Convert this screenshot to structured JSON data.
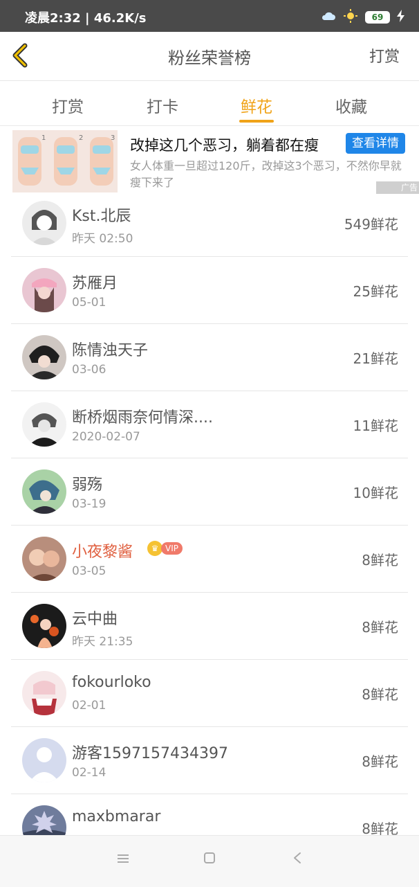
{
  "status_bar": {
    "left_text": "凌晨2:32 | 46.2K/s",
    "battery": "69"
  },
  "header": {
    "title": "粉丝荣誉榜",
    "action": "打赏"
  },
  "tabs": [
    {
      "label": "打赏"
    },
    {
      "label": "打卡"
    },
    {
      "label": "鲜花",
      "active": true
    },
    {
      "label": "收藏"
    }
  ],
  "ad": {
    "title": "改掉这几个恶习，躺着都在瘦",
    "button": "查看详情",
    "desc": "女人体重一旦超过120斤，改掉这3个恶习，不然你早就瘦下来了",
    "tag": "广告",
    "image_numbers": [
      "1",
      "2",
      "3"
    ]
  },
  "list": [
    {
      "name": "Kst.北辰",
      "time": "昨天 02:50",
      "count": "549鲜花"
    },
    {
      "name": "苏雁月",
      "time": "05-01",
      "count": "25鲜花"
    },
    {
      "name": "陈情浊天子",
      "time": "03-06",
      "count": "21鲜花"
    },
    {
      "name": "断桥烟雨奈何情深....",
      "time": "2020-02-07",
      "count": "11鲜花"
    },
    {
      "name": "弱殇",
      "time": "03-19",
      "count": "10鲜花"
    },
    {
      "name": "小夜黎酱",
      "time": "03-05",
      "count": "8鲜花",
      "vip": "VIP"
    },
    {
      "name": "云中曲",
      "time": "昨天 21:35",
      "count": "8鲜花"
    },
    {
      "name": "fokourloko",
      "time": "02-01",
      "count": "8鲜花"
    },
    {
      "name": "游客1597157434397",
      "time": "02-14",
      "count": "8鲜花"
    },
    {
      "name": "maxbmarar",
      "time": "",
      "count": "8鲜花"
    }
  ],
  "colors": {
    "accent": "#f0a318",
    "vip_name": "#e06040",
    "ad_button": "#1f86e8"
  }
}
